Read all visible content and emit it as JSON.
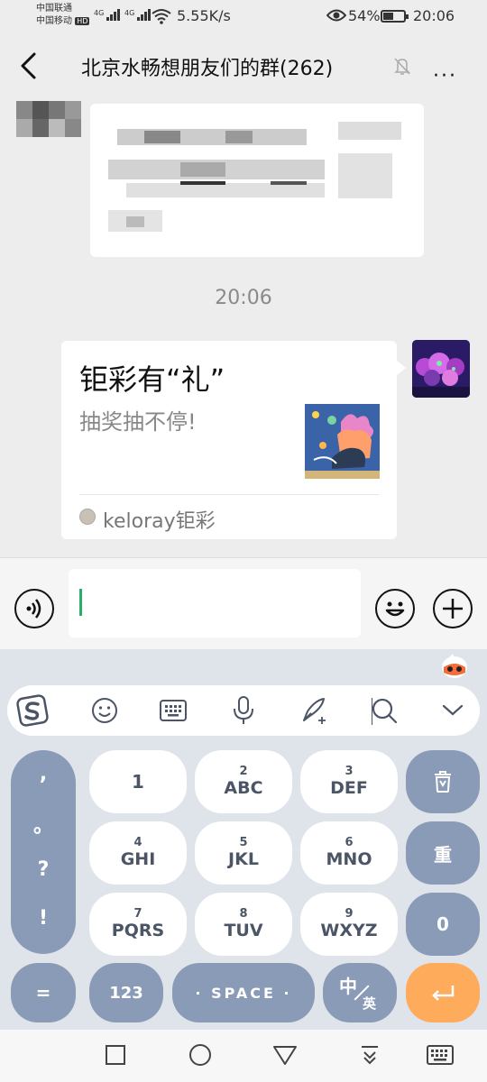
{
  "status_bar": {
    "carrier_1": "中国联通",
    "carrier_2": "中国移动",
    "hd_badge": "HD",
    "net_type_1": "4G",
    "net_type_2": "4G",
    "network_speed": "5.55K/s",
    "battery_percent": "54%",
    "battery_level": 0.54,
    "time": "20:06"
  },
  "header": {
    "title": "北京水畅想朋友们的群(262)",
    "back_icon": "chevron-left-icon",
    "mute_icon": "bell-off-icon",
    "more_label": "···"
  },
  "chat": {
    "timestamp": "20:06",
    "card": {
      "title": "钜彩有“礼”",
      "description": "抽奖抽不停!",
      "source": "keloray钜彩"
    }
  },
  "input_bar": {
    "voice_icon": "voice-icon",
    "emoji_icon": "emoji-icon",
    "plus_icon": "plus-icon"
  },
  "keyboard": {
    "toolbar_icons": [
      "sogou-logo-icon",
      "emoji-icon",
      "keyboard-icon",
      "microphone-icon",
      "handwriting-icon",
      "search-icon",
      "chevron-down-icon"
    ],
    "punctuation": [
      ",",
      "。",
      "?",
      "!"
    ],
    "keys": [
      {
        "num": "",
        "letters": "1"
      },
      {
        "num": "2",
        "letters": "ABC"
      },
      {
        "num": "3",
        "letters": "DEF"
      },
      {
        "num": "4",
        "letters": "GHI"
      },
      {
        "num": "5",
        "letters": "JKL"
      },
      {
        "num": "6",
        "letters": "MNO"
      },
      {
        "num": "7",
        "letters": "PQRS"
      },
      {
        "num": "8",
        "letters": "TUV"
      },
      {
        "num": "9",
        "letters": "WXYZ"
      }
    ],
    "delete_icon": "delete-icon",
    "redo_label": "重",
    "zero_label": "0",
    "equals_label": "=",
    "numbers_label": "123",
    "space_label": "· SPACE ·",
    "lang_cn": "中",
    "lang_en": "英",
    "enter_icon": "enter-icon"
  },
  "system_nav": {
    "icons": [
      "recent-apps-icon",
      "home-icon",
      "back-triangle-icon",
      "download-icon",
      "keyboard-toggle-icon"
    ]
  },
  "colors": {
    "accent_green": "#2aae67",
    "key_blue": "#8a9bb8",
    "key_orange": "#ffab5c"
  }
}
